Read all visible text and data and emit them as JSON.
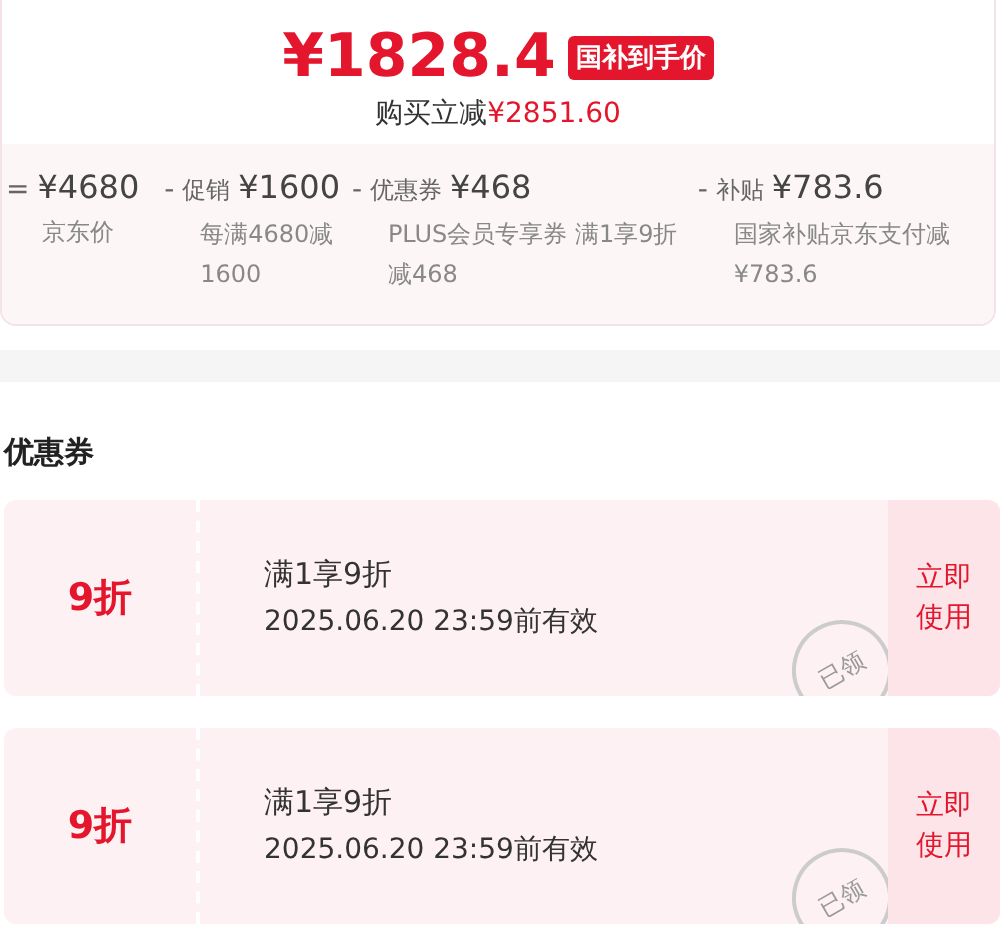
{
  "price": {
    "amount": "¥1828.4",
    "badge": "国补到手价",
    "savings_label": "购买立减",
    "savings_amount": "¥2851.60"
  },
  "breakdown": [
    {
      "operator": "=",
      "amount": "¥4680",
      "note": "京东价"
    },
    {
      "operator": "-",
      "label": "促销",
      "amount": "¥1600",
      "note": "每满4680减1600"
    },
    {
      "operator": "-",
      "label": "优惠券",
      "amount": "¥468",
      "note": "PLUS会员专享券 满1享9折减468"
    },
    {
      "operator": "-",
      "label": "补贴",
      "amount": "¥783.6",
      "note": "国家补贴京东支付减¥783.6"
    }
  ],
  "coupons_heading": "优惠券",
  "coupons": [
    {
      "value": "9折",
      "title": "满1享9折",
      "validity": "2025.06.20 23:59前有效",
      "stamp": "已领",
      "action": "立即使用"
    },
    {
      "value": "9折",
      "title": "满1享9折",
      "validity": "2025.06.20 23:59前有效",
      "stamp": "已领",
      "action": "立即使用"
    }
  ]
}
